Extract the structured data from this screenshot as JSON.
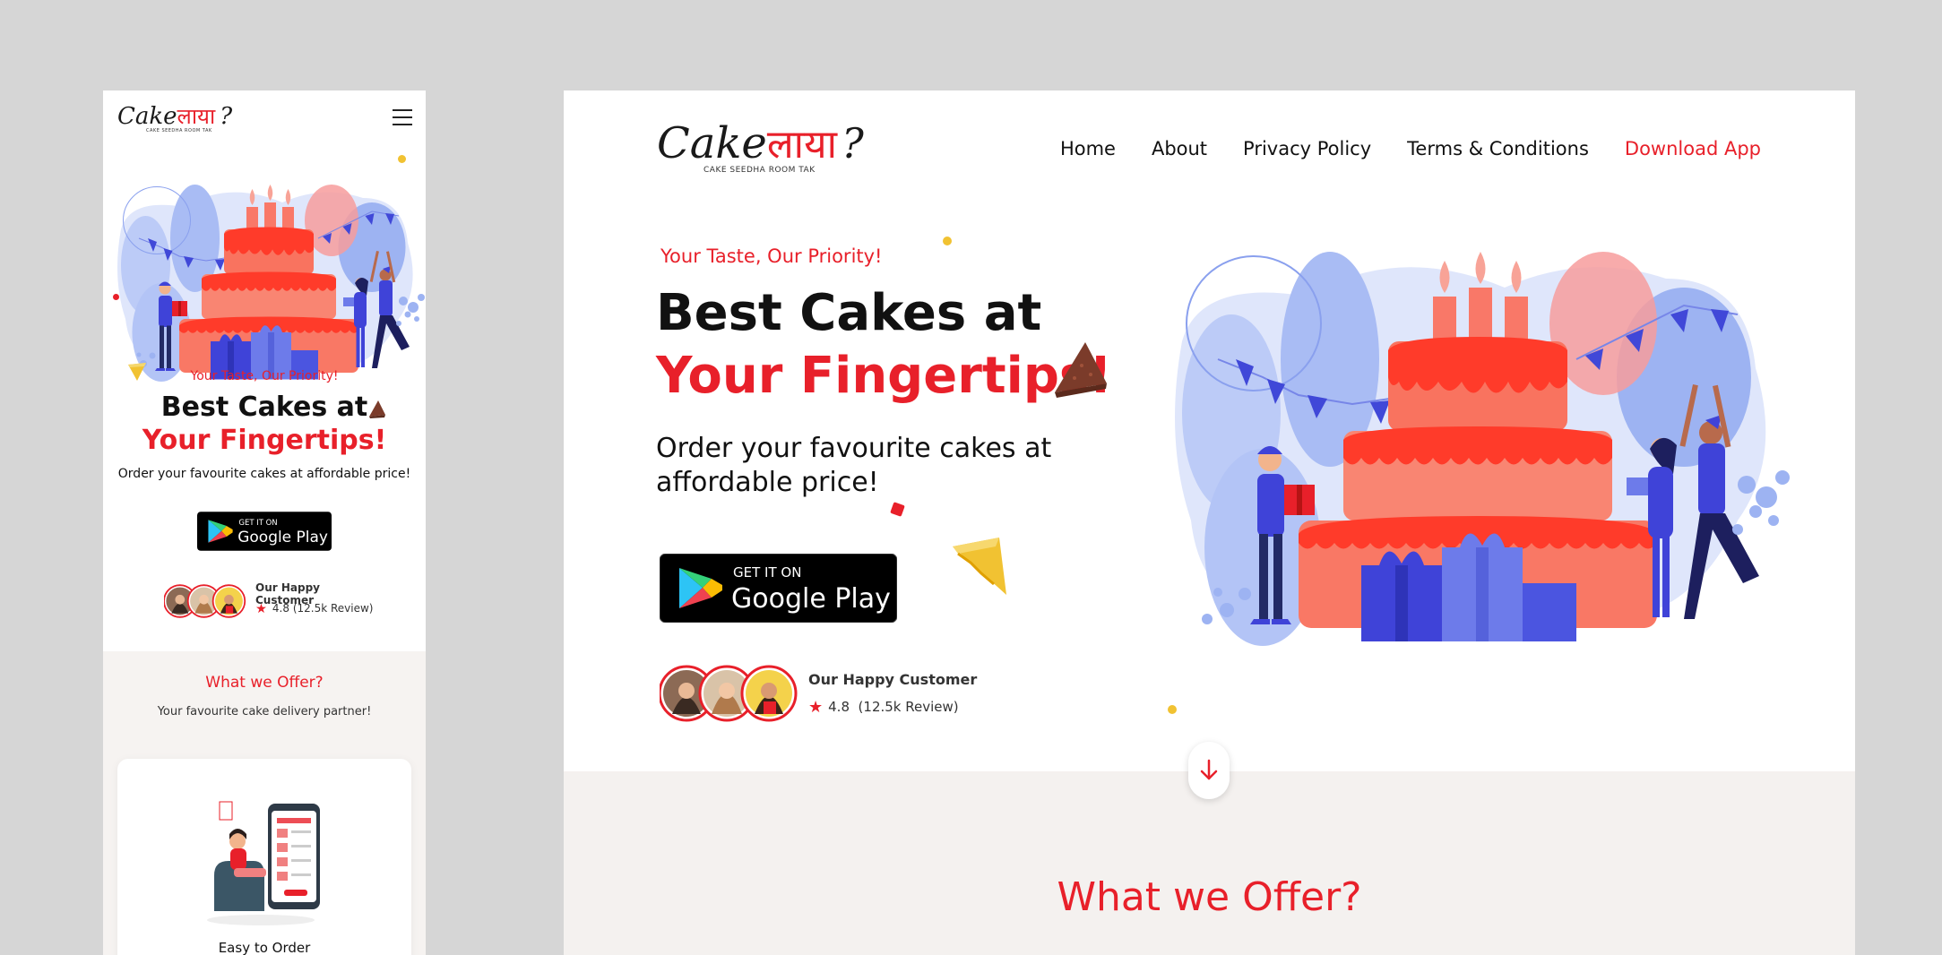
{
  "brand": {
    "logo_latin": "Cake",
    "logo_hindi": "लाया",
    "logo_mark": "?",
    "tagline": "CAKE SEEDHA ROOM TAK"
  },
  "nav": {
    "home": "Home",
    "about": "About",
    "privacy": "Privacy Policy",
    "terms": "Terms & Conditions",
    "download": "Download App"
  },
  "hero": {
    "eyebrow": "Your Taste, Our Priority!",
    "title_line1": "Best Cakes at",
    "title_line2": "Your Fingertips!",
    "subtitle": "Order your favourite cakes at affordable price!",
    "play_small": "GET IT ON",
    "play_big": "Google Play"
  },
  "customers": {
    "label": "Our Happy Customer",
    "rating": "4.8",
    "reviews": "(12.5k Review)"
  },
  "offer": {
    "title": "What we Offer?",
    "subtitle": "Your favourite cake delivery partner!",
    "card_title": "Easy to Order"
  },
  "colors": {
    "accent": "#e8202a",
    "text": "#111111",
    "background": "#d6d6d6",
    "illustration_blue": "#3f43d8",
    "illustration_light_blue": "#b8c8f6"
  },
  "icons": {
    "menu": "hamburger-icon",
    "scroll": "arrow-down-icon",
    "rating": "star-icon",
    "store": "google-play-icon"
  }
}
